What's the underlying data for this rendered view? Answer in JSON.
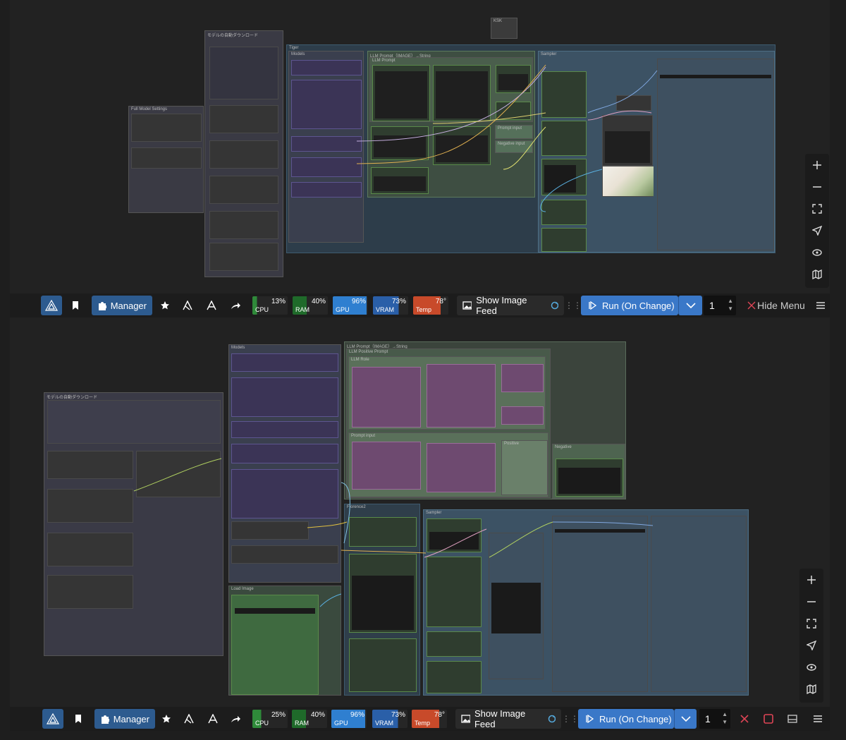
{
  "top": {
    "groups": {
      "topright_small": "KSK",
      "model_download": "モデルの自動ダウンロード",
      "full_model_settings": "Full Model Settings",
      "main": "Tiger",
      "models": "Models",
      "llm_prompt": "LLM Prompt（IMAGE）→String",
      "llm_prompt_inner": "LLM Prompt",
      "sampler": "Sampler",
      "prompt_input": "Prompt input",
      "negative_input": "Negative input"
    }
  },
  "bottom": {
    "groups": {
      "model_download": "モデルの自動ダウンロード",
      "models": "Models",
      "llm_prompt": "LLM Prompt（IMAGE）→String",
      "llm_positive": "LLM Positive Prompt",
      "llm_role": "LLM Role",
      "prompt_input": "Prompt input",
      "positive": "Positive",
      "negative": "Negative",
      "florence": "Florence2",
      "sampler": "Sampler",
      "load_image": "Load Image"
    }
  },
  "toolbar_top": {
    "manager_label": "Manager",
    "cpu_pct": "13%",
    "cpu_label": "CPU",
    "ram_pct": "40%",
    "ram_label": "RAM",
    "gpu_pct": "96%",
    "gpu_label": "GPU",
    "vram_pct": "73%",
    "vram_label": "VRAM",
    "temp_val": "78°",
    "temp_label": "Temp",
    "feed_label": "Show Image Feed",
    "run_label": "Run (On Change)",
    "batch_count": "1",
    "hide_menu_label": "Hide Menu"
  },
  "toolbar_bottom": {
    "manager_label": "Manager",
    "cpu_pct": "25%",
    "cpu_label": "CPU",
    "ram_pct": "40%",
    "ram_label": "RAM",
    "gpu_pct": "96%",
    "gpu_label": "GPU",
    "vram_pct": "73%",
    "vram_label": "VRAM",
    "temp_val": "78°",
    "temp_label": "Temp",
    "feed_label": "Show Image Feed",
    "run_label": "Run (On Change)",
    "batch_count": "1"
  },
  "colors": {
    "cpu": "#2f8a3a",
    "ram": "#1f6a2a",
    "gpu": "#2f7fd0",
    "vram": "#2a5fa8",
    "temp": "#c84a2a",
    "run": "#3a78c8",
    "manager": "#2d5b8f"
  },
  "icons": [
    "comfy-logo-icon",
    "bookmark-icon",
    "puzzle-icon",
    "star-icon",
    "workflow-icon",
    "share-icon",
    "image-icon",
    "refresh-icon",
    "play-icon",
    "chevron-down-icon",
    "plus-icon",
    "minus-icon",
    "fit-view-icon",
    "navigate-icon",
    "eye-icon",
    "map-icon",
    "close-icon",
    "menu-icon"
  ]
}
